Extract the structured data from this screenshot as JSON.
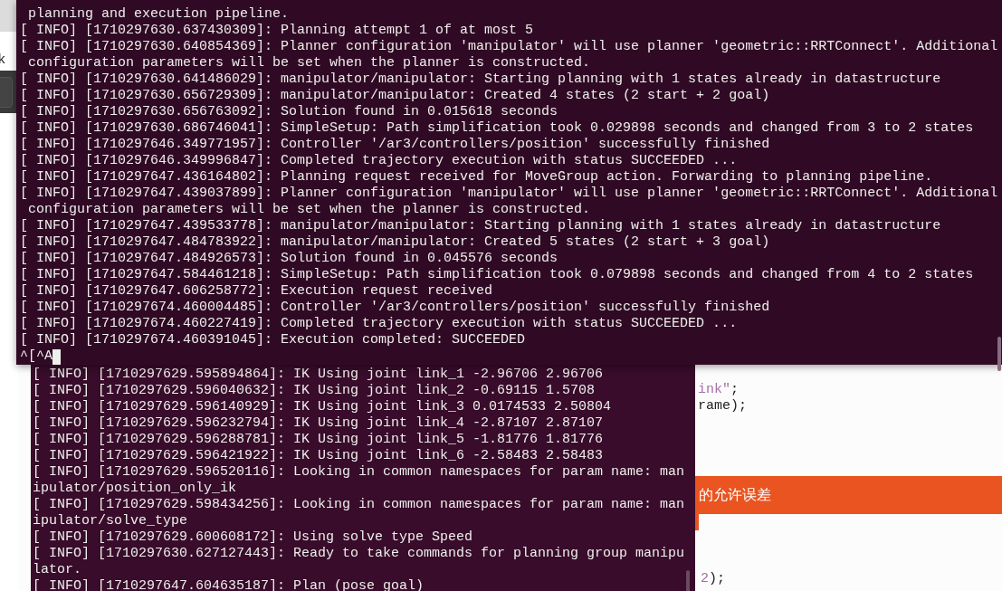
{
  "background_window": {
    "text": "k"
  },
  "top_terminal": {
    "lines": [
      " planning and execution pipeline.",
      "[ INFO] [1710297630.637430309]: Planning attempt 1 of at most 5",
      "[ INFO] [1710297630.640854369]: Planner configuration 'manipulator' will use planner 'geometric::RRTConnect'. Additional",
      " configuration parameters will be set when the planner is constructed.",
      "[ INFO] [1710297630.641486029]: manipulator/manipulator: Starting planning with 1 states already in datastructure",
      "[ INFO] [1710297630.656729309]: manipulator/manipulator: Created 4 states (2 start + 2 goal)",
      "[ INFO] [1710297630.656763092]: Solution found in 0.015618 seconds",
      "[ INFO] [1710297630.686746041]: SimpleSetup: Path simplification took 0.029898 seconds and changed from 3 to 2 states",
      "[ INFO] [1710297646.349771957]: Controller '/ar3/controllers/position' successfully finished",
      "[ INFO] [1710297646.349996847]: Completed trajectory execution with status SUCCEEDED ...",
      "[ INFO] [1710297647.436164802]: Planning request received for MoveGroup action. Forwarding to planning pipeline.",
      "[ INFO] [1710297647.439037899]: Planner configuration 'manipulator' will use planner 'geometric::RRTConnect'. Additional",
      " configuration parameters will be set when the planner is constructed.",
      "[ INFO] [1710297647.439533778]: manipulator/manipulator: Starting planning with 1 states already in datastructure",
      "[ INFO] [1710297647.484783922]: manipulator/manipulator: Created 5 states (2 start + 3 goal)",
      "[ INFO] [1710297647.484926573]: Solution found in 0.045576 seconds",
      "[ INFO] [1710297647.584461218]: SimpleSetup: Path simplification took 0.079898 seconds and changed from 4 to 2 states",
      "[ INFO] [1710297647.606258772]: Execution request received",
      "[ INFO] [1710297674.460004485]: Controller '/ar3/controllers/position' successfully finished",
      "[ INFO] [1710297674.460227419]: Completed trajectory execution with status SUCCEEDED ...",
      "[ INFO] [1710297674.460391045]: Execution completed: SUCCEEDED"
    ],
    "prompt": "^[^A"
  },
  "bottom_terminal": {
    "lines": [
      "[ INFO] [1710297629.595894864]: IK Using joint link_1 -2.96706 2.96706",
      "[ INFO] [1710297629.596040632]: IK Using joint link_2 -0.69115 1.5708",
      "[ INFO] [1710297629.596140929]: IK Using joint link_3 0.0174533 2.50804",
      "[ INFO] [1710297629.596232794]: IK Using joint link_4 -2.87107 2.87107",
      "[ INFO] [1710297629.596288781]: IK Using joint link_5 -1.81776 1.81776",
      "[ INFO] [1710297629.596421922]: IK Using joint link_6 -2.58483 2.58483",
      "[ INFO] [1710297629.596520116]: Looking in common namespaces for param name: man",
      "ipulator/position_only_ik",
      "[ INFO] [1710297629.598434256]: Looking in common namespaces for param name: man",
      "ipulator/solve_type",
      "[ INFO] [1710297629.600608172]: Using solve type Speed",
      "[ INFO] [1710297630.627127443]: Ready to take commands for planning group manipu",
      "lator.",
      "[ INFO] [1710297647.604635187]: Plan (pose goal)"
    ]
  },
  "editor": {
    "code_top": [
      [
        {
          "text": "ink\"",
          "kind": "string"
        },
        {
          "text": ";",
          "kind": "plain"
        }
      ],
      [
        {
          "text": "rame);",
          "kind": "plain"
        }
      ]
    ],
    "banner": "的允许误差",
    "code_bottom": [
      [
        {
          "text": "2",
          "kind": "number"
        },
        {
          "text": ");",
          "kind": "plain"
        }
      ]
    ]
  }
}
